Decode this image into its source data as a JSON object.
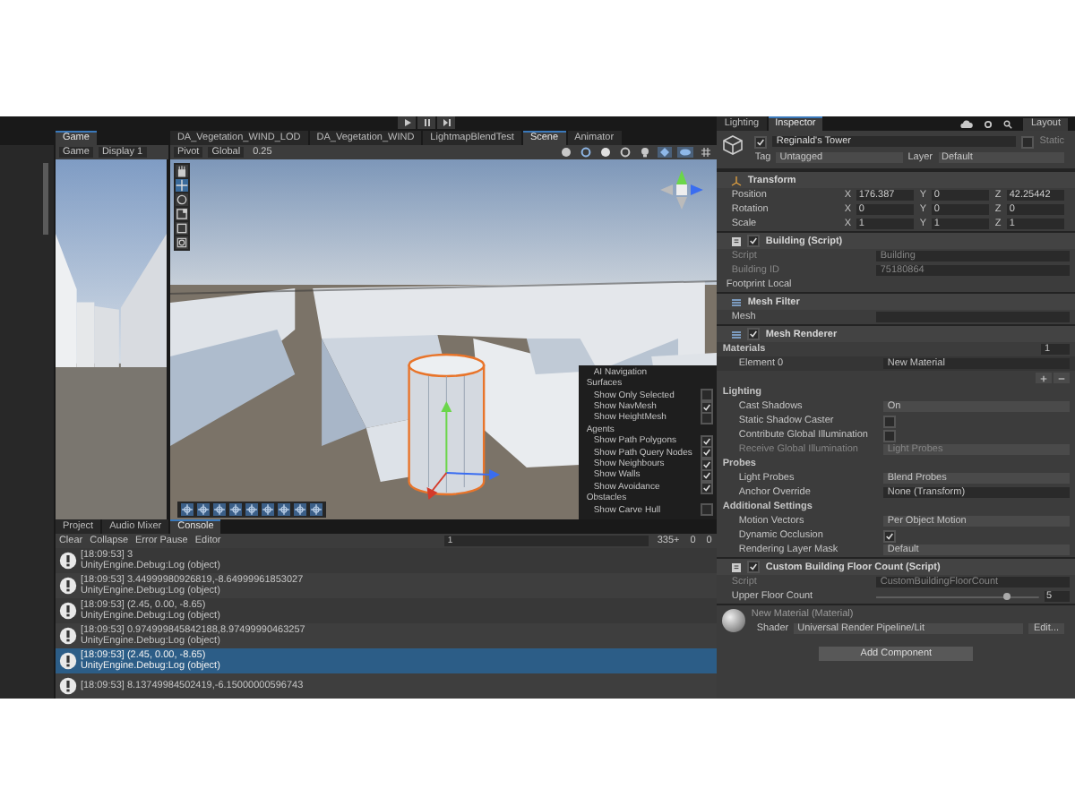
{
  "toolbar": {
    "layout": "Layout"
  },
  "game_panel": {
    "tab": "Game",
    "view_mode": "Game",
    "display": "Display 1"
  },
  "scene_tabs": [
    {
      "label": "DA_Vegetation_WIND_LOD",
      "selected": false
    },
    {
      "label": "DA_Vegetation_WIND",
      "selected": false
    },
    {
      "label": "LightmapBlendTest",
      "selected": false
    },
    {
      "label": "Scene",
      "selected": true
    },
    {
      "label": "Animator",
      "selected": false
    }
  ],
  "scene_toolbar": {
    "pivot": "Pivot",
    "space": "Global",
    "snap": "0.25"
  },
  "nav_overlay": {
    "title": "AI Navigation",
    "groups": [
      {
        "name": "Surfaces",
        "options": [
          {
            "label": "Show Only Selected",
            "checked": false
          },
          {
            "label": "Show NavMesh",
            "checked": true
          },
          {
            "label": "Show HeightMesh",
            "checked": false
          }
        ]
      },
      {
        "name": "Agents",
        "options": [
          {
            "label": "Show Path Polygons",
            "checked": true
          },
          {
            "label": "Show Path Query Nodes",
            "checked": true
          },
          {
            "label": "Show Neighbours",
            "checked": true
          },
          {
            "label": "Show Walls",
            "checked": true
          },
          {
            "label": "Show Avoidance",
            "checked": true
          }
        ]
      },
      {
        "name": "Obstacles",
        "options": [
          {
            "label": "Show Carve Hull",
            "checked": false
          }
        ]
      }
    ]
  },
  "console": {
    "tabs": [
      {
        "label": "Project",
        "selected": false
      },
      {
        "label": "Audio Mixer",
        "selected": false
      },
      {
        "label": "Console",
        "selected": true
      }
    ],
    "clear": "Clear",
    "collapse": "Collapse",
    "error_pause": "Error Pause",
    "editor": "Editor",
    "search": "1",
    "log_count": "335+",
    "warning_count": "0",
    "error_count": "0",
    "rows": [
      {
        "message": "[18:09:53] 3",
        "source": "UnityEngine.Debug:Log (object)",
        "selected": false
      },
      {
        "message": "[18:09:53] 3.44999980926819,-8.64999961853027",
        "source": "UnityEngine.Debug:Log (object)",
        "selected": false
      },
      {
        "message": "[18:09:53] (2.45, 0.00, -8.65)",
        "source": "UnityEngine.Debug:Log (object)",
        "selected": false
      },
      {
        "message": "[18:09:53] 0.974999845842188,8.97499990463257",
        "source": "UnityEngine.Debug:Log (object)",
        "selected": false
      },
      {
        "message": "[18:09:53] (2.45, 0.00, -8.65)",
        "source": "UnityEngine.Debug:Log (object)",
        "selected": true
      },
      {
        "message": "[18:09:53] 8.13749984502419,-6.15000000596743",
        "selected": false
      }
    ]
  },
  "inspector": {
    "tabs": [
      {
        "label": "Lighting",
        "selected": false
      },
      {
        "label": "Inspector",
        "selected": true
      }
    ],
    "object": {
      "name": "Reginald's Tower",
      "active": true,
      "static_label": "Static",
      "static": false,
      "tag_label": "Tag",
      "tag": "Untagged",
      "layer_label": "Layer",
      "layer": "Default"
    },
    "transform": {
      "title": "Transform",
      "rows": [
        {
          "label": "Position",
          "axes": [
            "X",
            "Y",
            "Z"
          ],
          "values": [
            "176.387",
            "0",
            "42.25442"
          ]
        },
        {
          "label": "Rotation",
          "axes": [
            "X",
            "Y",
            "Z"
          ],
          "values": [
            "0",
            "0",
            "0"
          ]
        },
        {
          "label": "Scale",
          "axes": [
            "X",
            "Y",
            "Z"
          ],
          "values": [
            "1",
            "1",
            "1"
          ]
        }
      ]
    },
    "building": {
      "title": "Building (Script)",
      "enabled": true,
      "fields": [
        {
          "label": "Script",
          "value": "Building"
        },
        {
          "label": "Building ID",
          "value": "75180864"
        }
      ],
      "foldout": "Footprint Local"
    },
    "mesh_filter": {
      "title": "Mesh Filter",
      "field": "Mesh"
    },
    "mesh_renderer": {
      "title": "Mesh Renderer",
      "enabled": true,
      "materials_label": "Materials",
      "materials_count": "1",
      "element_label": "Element 0",
      "element_value": "New Material",
      "sections": [
        {
          "title": "Lighting",
          "rows": [
            {
              "kind": "dropdown",
              "label": "Cast Shadows",
              "value": "On",
              "disabled": false
            },
            {
              "kind": "checkbox",
              "label": "Static Shadow Caster",
              "checked": false,
              "disabled": false
            },
            {
              "kind": "checkbox",
              "label": "Contribute Global Illumination",
              "checked": false,
              "disabled": false
            },
            {
              "kind": "dropdown",
              "label": "Receive Global Illumination",
              "value": "Light Probes",
              "disabled": true
            }
          ]
        },
        {
          "title": "Probes",
          "rows": [
            {
              "kind": "dropdown",
              "label": "Light Probes",
              "value": "Blend Probes",
              "disabled": false
            },
            {
              "kind": "object",
              "label": "Anchor Override",
              "value": "None (Transform)",
              "disabled": false
            }
          ]
        },
        {
          "title": "Additional Settings",
          "rows": [
            {
              "kind": "dropdown",
              "label": "Motion Vectors",
              "value": "Per Object Motion",
              "disabled": false
            },
            {
              "kind": "checkbox",
              "label": "Dynamic Occlusion",
              "checked": true,
              "disabled": false
            },
            {
              "kind": "dropdown",
              "label": "Rendering Layer Mask",
              "value": "Default",
              "disabled": false
            }
          ]
        }
      ]
    },
    "floor_count": {
      "title": "Custom Building Floor Count (Script)",
      "enabled": true,
      "script_label": "Script",
      "script": "CustomBuildingFloorCount",
      "slider_label": "Upper Floor Count",
      "level": 0.8,
      "value": "5"
    },
    "material": {
      "name": "New Material (Material)",
      "shader_label": "Shader",
      "shader": "Universal Render Pipeline/Lit",
      "edit": "Edit..."
    },
    "add_component": "Add Component"
  }
}
